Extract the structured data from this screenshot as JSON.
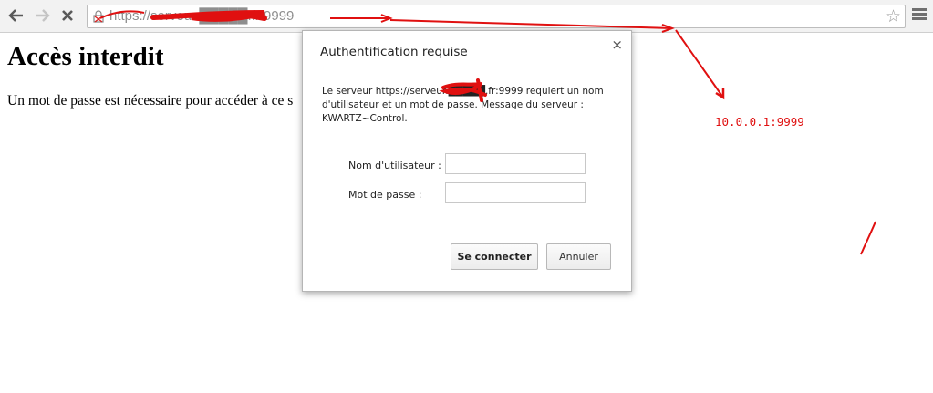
{
  "browser": {
    "url_scheme": "https://",
    "url_rest": "serveur.█████.fr:9999"
  },
  "page": {
    "title": "Accès interdit",
    "text": "Un mot de passe est nécessaire pour accéder à ce s"
  },
  "dialog": {
    "title": "Authentification requise",
    "close_glyph": "×",
    "message": "Le serveur https://serveur.█████.fr:9999 requiert un nom d'utilisateur et un mot de passe. Message du serveur : KWARTZ~Control.",
    "username_label": "Nom d'utilisateur :",
    "password_label": "Mot de passe :",
    "username_value": "",
    "password_value": "",
    "connect_label": "Se connecter",
    "cancel_label": "Annuler"
  },
  "annotation": {
    "text": "10.0.0.1:9999",
    "color": "#e01010"
  },
  "icons": {
    "back": "arrow-left-icon",
    "forward": "arrow-right-icon",
    "stop": "close-icon",
    "lock": "lock-broken-icon",
    "star": "star-icon",
    "menu": "hamburger-menu-icon"
  }
}
